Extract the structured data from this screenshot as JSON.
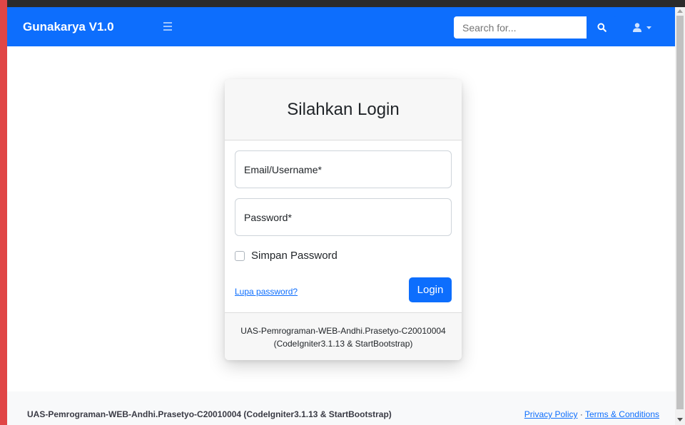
{
  "navbar": {
    "brand": "Gunakarya V1.0",
    "search_placeholder": "Search for...",
    "icons": [
      "menu-icon",
      "search-icon",
      "user-icon",
      "caret-down-icon"
    ]
  },
  "login": {
    "title": "Silahkan Login",
    "email_placeholder": "Email/Username*",
    "password_placeholder": "Password*",
    "remember_label": "Simpan Password",
    "forgot_label": "Lupa password?",
    "login_button": "Login",
    "footer_line1": "UAS-Pemrograman-WEB-Andhi.Prasetyo-C20010004",
    "footer_line2": "(CodeIgniter3.1.13 & StartBootstrap)"
  },
  "footer": {
    "copyright": "UAS-Pemrograman-WEB-Andhi.Prasetyo-C20010004 (CodeIgniter3.1.13 & StartBootstrap)",
    "privacy": "Privacy Policy",
    "separator": "·",
    "terms": "Terms & Conditions"
  },
  "colors": {
    "primary": "#0d6efd",
    "left_accent": "#e04646"
  }
}
